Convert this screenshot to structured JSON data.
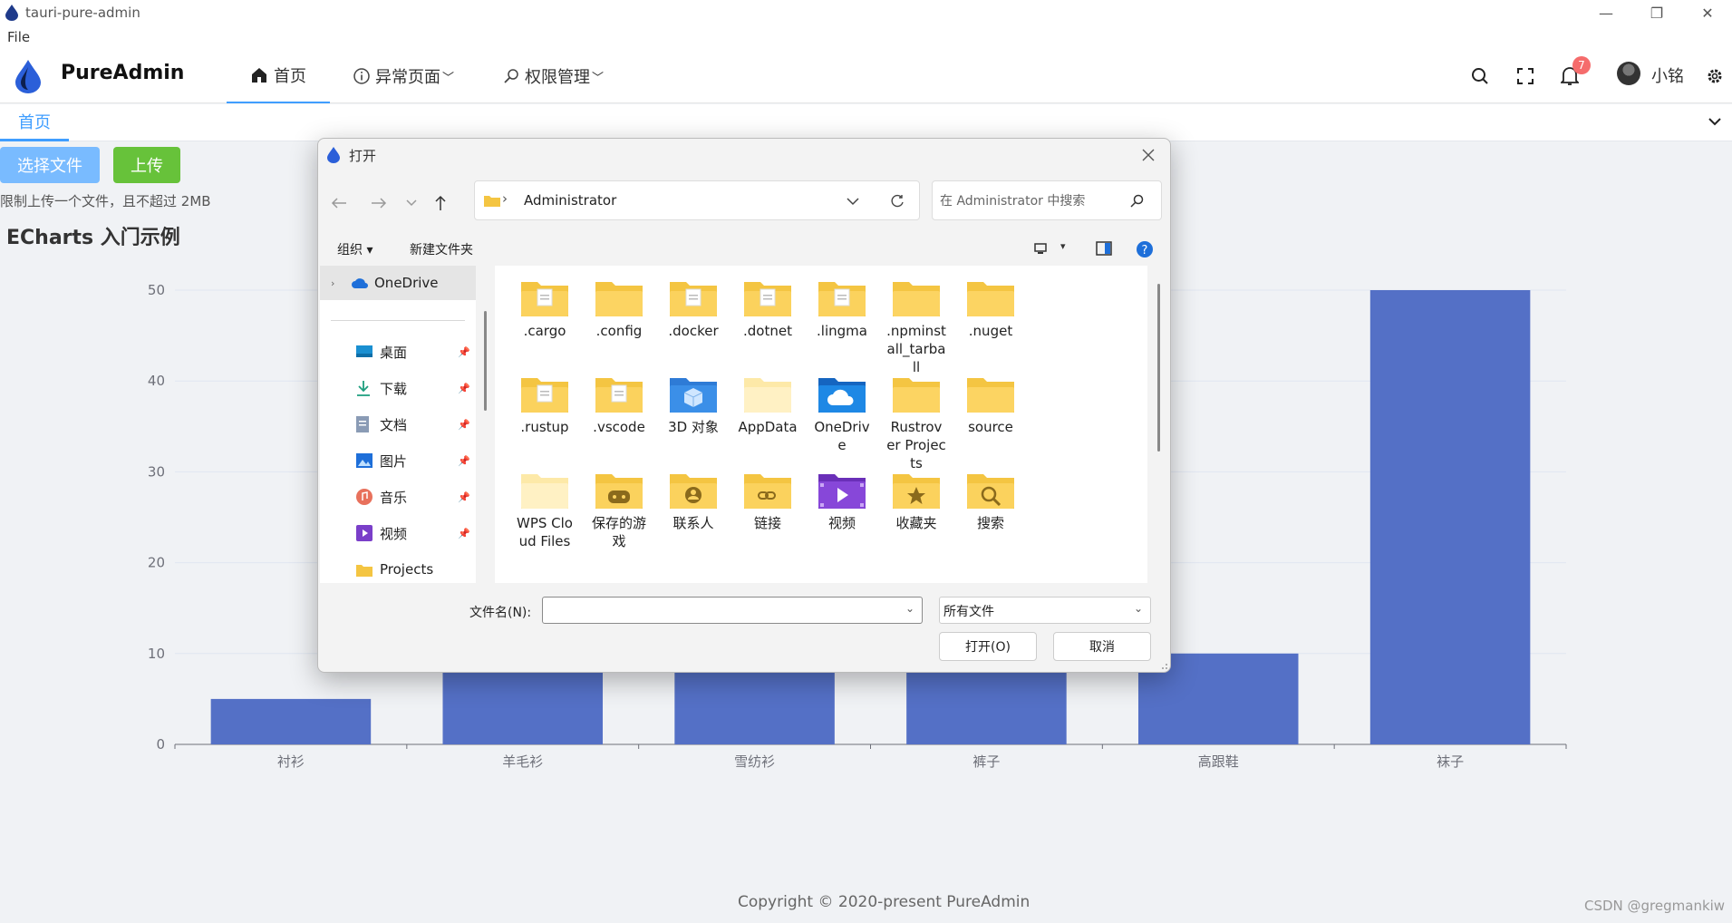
{
  "os": {
    "window_title": "tauri-pure-admin",
    "menu_file": "File"
  },
  "header": {
    "brand": "PureAdmin",
    "nav": [
      {
        "label": "首页",
        "icon": "home-icon"
      },
      {
        "label": "异常页面",
        "icon": "info-icon"
      },
      {
        "label": "权限管理",
        "icon": "key-icon"
      }
    ],
    "notification_count": "7",
    "user_name": "小铭"
  },
  "tags": {
    "home": "首页"
  },
  "upload": {
    "select_label": "选择文件",
    "upload_label": "上传",
    "tip": "限制上传一个文件，且不超过 2MB"
  },
  "chart_heading": "ECharts 入门示例",
  "chart_data": {
    "type": "bar",
    "categories": [
      "衬衫",
      "羊毛衫",
      "雪纺衫",
      "裤子",
      "高跟鞋",
      "袜子"
    ],
    "values": [
      5,
      20,
      36,
      10,
      10,
      50
    ],
    "y_ticks": [
      "0",
      "10",
      "20",
      "30",
      "40",
      "50"
    ],
    "ylim": [
      0,
      50
    ],
    "color": "#5470c6",
    "grid": true
  },
  "footer": "Copyright © 2020-present PureAdmin",
  "watermark": "CSDN @gregmankiw",
  "dialog": {
    "title": "打开",
    "path": "Administrator",
    "search_placeholder": "在 Administrator 中搜索",
    "organize": "组织 ▾",
    "new_folder": "新建文件夹",
    "sidebar": {
      "onedrive": "OneDrive",
      "items": [
        {
          "label": "桌面",
          "icon": "desktop-icon"
        },
        {
          "label": "下载",
          "icon": "download-icon"
        },
        {
          "label": "文档",
          "icon": "document-icon"
        },
        {
          "label": "图片",
          "icon": "pictures-icon"
        },
        {
          "label": "音乐",
          "icon": "music-icon"
        },
        {
          "label": "视频",
          "icon": "video-icon"
        },
        {
          "label": "Projects",
          "icon": "folder-icon"
        }
      ]
    },
    "files": [
      {
        "name": ".cargo",
        "kind": "doc"
      },
      {
        "name": ".config",
        "kind": "plain"
      },
      {
        "name": ".docker",
        "kind": "doc"
      },
      {
        "name": ".dotnet",
        "kind": "doc"
      },
      {
        "name": ".lingma",
        "kind": "doc"
      },
      {
        "name": ".npminstall_tarball",
        "kind": "plain"
      },
      {
        "name": ".nuget",
        "kind": "plain"
      },
      {
        "name": ".rustup",
        "kind": "doc"
      },
      {
        "name": ".vscode",
        "kind": "doc"
      },
      {
        "name": "3D 对象",
        "kind": "3d"
      },
      {
        "name": "AppData",
        "kind": "light"
      },
      {
        "name": "OneDrive",
        "kind": "cloud"
      },
      {
        "name": "Rustrover Projects",
        "kind": "plain"
      },
      {
        "name": "source",
        "kind": "plain"
      },
      {
        "name": "WPS Cloud Files",
        "kind": "light"
      },
      {
        "name": "保存的游戏",
        "kind": "game"
      },
      {
        "name": "联系人",
        "kind": "contact"
      },
      {
        "name": "链接",
        "kind": "link"
      },
      {
        "name": "视频",
        "kind": "video"
      },
      {
        "name": "收藏夹",
        "kind": "star"
      },
      {
        "name": "搜索",
        "kind": "search"
      }
    ],
    "filename_label": "文件名(N):",
    "filename_value": "",
    "filetype": "所有文件",
    "open_label": "打开(O)",
    "cancel_label": "取消"
  }
}
